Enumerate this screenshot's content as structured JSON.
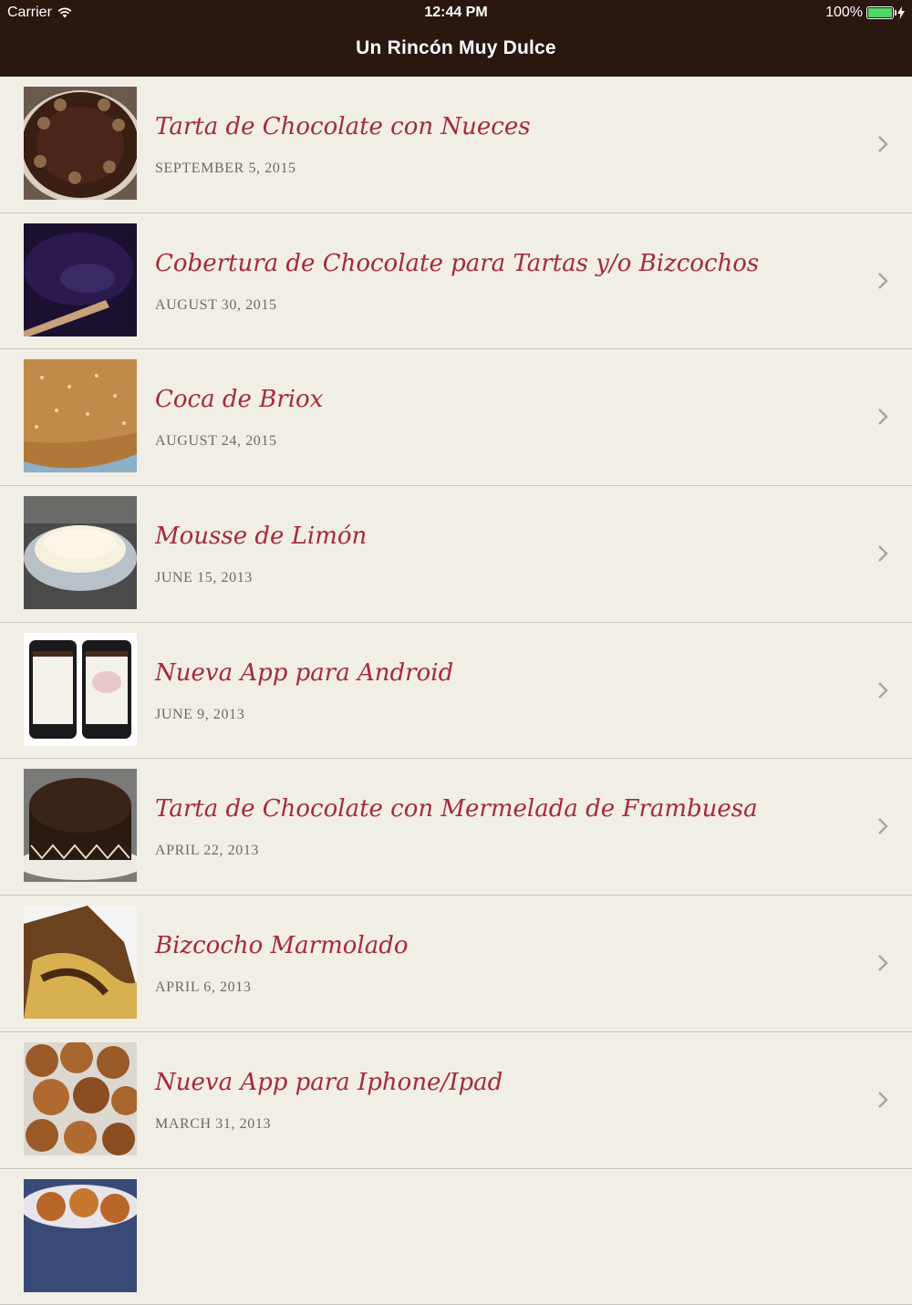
{
  "status_bar": {
    "carrier": "Carrier",
    "time": "12:44 PM",
    "battery": "100%",
    "icons": [
      "wifi-icon",
      "battery-icon",
      "charging-icon"
    ]
  },
  "nav": {
    "title": "Un Rincón Muy Dulce"
  },
  "colors": {
    "nav_bg": "#2a1710",
    "title_accent": "#a52a3a",
    "list_bg": "#f1eee6",
    "battery": "#4cd964"
  },
  "posts": [
    {
      "title": "Tarta de Chocolate con Nueces",
      "date": "SEPTEMBER 5, 2015"
    },
    {
      "title": "Cobertura de Chocolate para Tartas y/o Bizcochos",
      "date": "AUGUST 30, 2015"
    },
    {
      "title": "Coca de Briox",
      "date": "AUGUST 24, 2015"
    },
    {
      "title": "Mousse de Limón",
      "date": "JUNE 15, 2013"
    },
    {
      "title": "Nueva App para Android",
      "date": "JUNE 9, 2013"
    },
    {
      "title": "Tarta de Chocolate con Mermelada de Frambuesa",
      "date": "APRIL 22, 2013"
    },
    {
      "title": "Bizcocho Marmolado",
      "date": "APRIL 6, 2013"
    },
    {
      "title": "Nueva App para Iphone/Ipad",
      "date": "MARCH 31, 2013"
    },
    {
      "title": "",
      "date": ""
    }
  ]
}
